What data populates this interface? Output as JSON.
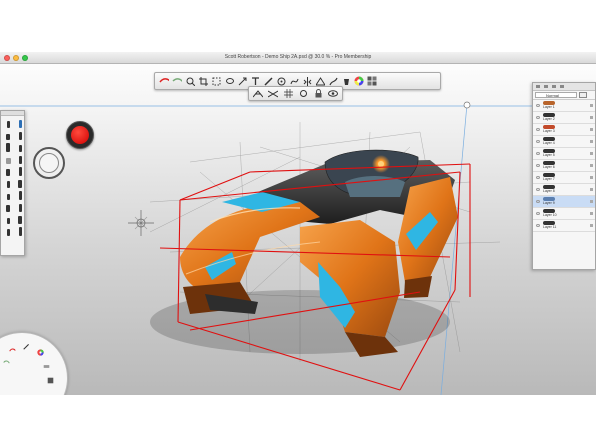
{
  "window": {
    "title": "Scott Robertson - Demo Ship 2A.psd @ 30.0 % - Pro Membership"
  },
  "main_toolbar": {
    "icons": [
      "undo-icon",
      "redo-icon",
      "zoom-icon",
      "crop-icon",
      "select-icon",
      "lasso-icon",
      "transform-icon",
      "text-icon",
      "ruler-icon",
      "ellipse-guide-icon",
      "french-curve-icon",
      "symmetry-icon",
      "perspective-icon",
      "stroke-icon",
      "fill-icon",
      "color-wheel-icon",
      "layers-icon"
    ]
  },
  "sub_toolbar": {
    "icons": [
      "perspective-grid-icon",
      "vanishing-point-icon",
      "grid-icon",
      "snap-icon",
      "lock-icon",
      "visibility-icon"
    ]
  },
  "layers_panel": {
    "blend_mode": "Normal",
    "layers": [
      {
        "name": "Layer 1",
        "color": "#b8642b"
      },
      {
        "name": "Layer 2",
        "color": "#333333"
      },
      {
        "name": "Layer 3",
        "color": "#c24a2a"
      },
      {
        "name": "Layer 4",
        "color": "#333333"
      },
      {
        "name": "Layer 5",
        "color": "#333333"
      },
      {
        "name": "Layer 6",
        "color": "#333333"
      },
      {
        "name": "Layer 7",
        "color": "#333333"
      },
      {
        "name": "Layer 8",
        "color": "#333333"
      },
      {
        "name": "Layer 9",
        "color": "#5b7fb0"
      },
      {
        "name": "Layer 10",
        "color": "#333333"
      },
      {
        "name": "Layer 11",
        "color": "#333333"
      }
    ]
  },
  "colors": {
    "accent": "#e87b1e",
    "cyan": "#2fb6e3",
    "perspective_lines": "#e01010",
    "record": "#e00000"
  }
}
